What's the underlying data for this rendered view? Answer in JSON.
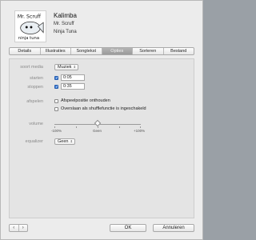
{
  "track": {
    "title": "Kalimba",
    "artist": "Mr. Scruff",
    "album": "Ninja Tuna",
    "artwork_text_top": "Mr. Scruff",
    "artwork_text_bottom": "ninja tuna"
  },
  "tabs": [
    {
      "label": "Details"
    },
    {
      "label": "Illustraties"
    },
    {
      "label": "Songtekst"
    },
    {
      "label": "Opties",
      "active": true
    },
    {
      "label": "Sorteren"
    },
    {
      "label": "Bestand"
    }
  ],
  "options": {
    "media_kind": {
      "label": "soort media",
      "value": "Muziek"
    },
    "start": {
      "label": "starten",
      "checked": true,
      "value": "0:05"
    },
    "stop": {
      "label": "stoppen",
      "checked": true,
      "value": "0:35"
    },
    "playback": {
      "label": "afspelen",
      "remember_position": {
        "label": "Afspeelpositie onthouden",
        "checked": false
      },
      "skip_shuffle": {
        "label": "Overslaan als shufflefunctie is ingeschakeld",
        "checked": false
      }
    },
    "volume": {
      "label": "volume",
      "min_label": "-100%",
      "mid_label": "Geen",
      "max_label": "+100%",
      "value_percent": 0
    },
    "equalizer": {
      "label": "equalizer",
      "value": "Geen"
    }
  },
  "footer": {
    "prev_icon": "chevron-left-icon",
    "next_icon": "chevron-right-icon",
    "ok_label": "OK",
    "cancel_label": "Annuleren"
  }
}
